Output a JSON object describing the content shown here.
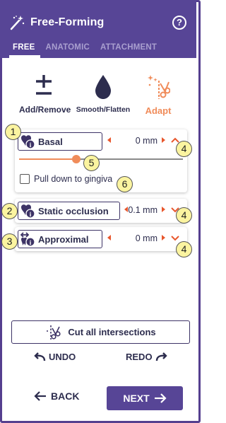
{
  "header": {
    "title": "Free-Forming",
    "help_glyph": "?",
    "tabs": [
      {
        "label": "FREE",
        "active": true
      },
      {
        "label": "ANATOMIC",
        "active": false
      },
      {
        "label": "ATTACHMENT",
        "active": false
      }
    ],
    "accent_color": "#574596"
  },
  "tools": [
    {
      "label": "Add/Remove",
      "icon": "plus-minus-icon",
      "active": false
    },
    {
      "label": "Smooth/Flatten",
      "icon": "droplet-icon",
      "active": false
    },
    {
      "label": "Adapt",
      "icon": "adapt-scissors-icon",
      "active": true
    }
  ],
  "sections": [
    {
      "label": "Basal",
      "value": "0 mm",
      "expanded": true,
      "icon": "tooth-info-icon",
      "slider_fraction": 0.35
    },
    {
      "label": "Static occlusion",
      "value": "0.1 mm",
      "expanded": false,
      "icon": "tooth-info-icon"
    },
    {
      "label": "Approximal",
      "value": "0 mm",
      "expanded": false,
      "icon": "approximal-info-icon"
    }
  ],
  "pull_down_label": "Pull down to gingiva",
  "pull_down_checked": false,
  "callouts": [
    "1",
    "2",
    "3",
    "4",
    "4",
    "4",
    "5",
    "6"
  ],
  "actions": {
    "cut_label": "Cut all intersections",
    "undo_label": "UNDO",
    "redo_label": "REDO",
    "back_label": "BACK",
    "next_label": "NEXT"
  },
  "colors": {
    "primary": "#574596",
    "highlight": "#f08c5a",
    "arrow": "#e8572d",
    "callout_fill": "#fbf4a0"
  }
}
